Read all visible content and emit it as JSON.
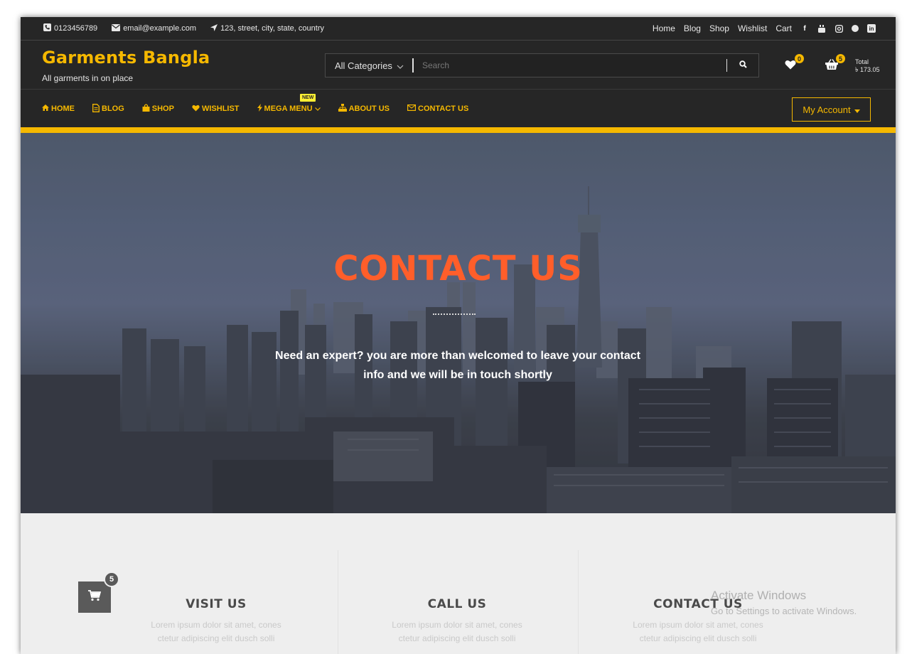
{
  "topbar": {
    "phone": "0123456789",
    "email": "email@example.com",
    "address": "123, street, city, state, country",
    "links": [
      "Home",
      "Blog",
      "Shop",
      "Wishlist",
      "Cart"
    ]
  },
  "brand": {
    "title": "Garments Bangla",
    "subtitle": "All garments in on place"
  },
  "search": {
    "category": "All Categories",
    "placeholder": "Search"
  },
  "header_icons": {
    "wishlist_count": "0",
    "cart_count": "5",
    "total_label": "Total",
    "total_value": "৳ 173.05"
  },
  "nav": {
    "items": [
      "HOME",
      "BLOG",
      "SHOP",
      "WISHLIST",
      "MEGA MENU",
      "ABOUT US",
      "CONTACT US"
    ],
    "new_badge": "NEW",
    "account": "My Account"
  },
  "hero": {
    "title": "CONTACT US",
    "subtitle_line1": "Need an expert? you are more than welcomed to leave your contact",
    "subtitle_line2": "info and we will be in touch shortly"
  },
  "info": {
    "cards": [
      {
        "title": "VISIT US",
        "line1": "Lorem ipsum dolor sit amet, cones",
        "line2": "ctetur adipiscing elit dusch solli"
      },
      {
        "title": "CALL US",
        "line1": "Lorem ipsum dolor sit amet, cones",
        "line2": "ctetur adipiscing elit dusch solli"
      },
      {
        "title": "CONTACT US",
        "line1": "Lorem ipsum dolor sit amet, cones",
        "line2": "ctetur adipiscing elit dusch solli"
      }
    ],
    "floating_cart_count": "5"
  },
  "watermark": {
    "line1": "Activate Windows",
    "line2": "Go to Settings to activate Windows."
  },
  "colors": {
    "accent": "#f5b800",
    "dark": "#262626",
    "hero_title": "#ff5e2a"
  }
}
